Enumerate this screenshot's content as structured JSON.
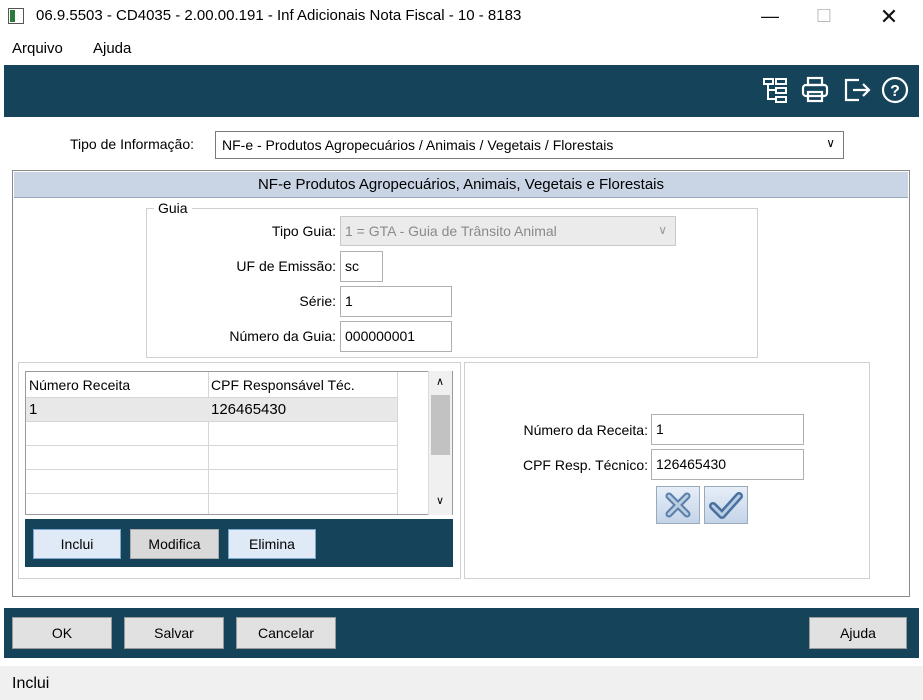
{
  "window": {
    "title": "06.9.5503 - CD4035 - 2.00.00.191 - Inf Adicionais Nota Fiscal - 10 - 8183",
    "min_glyph": "—",
    "max_glyph": "☐",
    "close_glyph": "✕"
  },
  "menu": {
    "items": [
      "Arquivo",
      "Ajuda"
    ]
  },
  "toolbar": {
    "icons": [
      "hierarchy-icon",
      "print-icon",
      "exit-icon",
      "help-icon"
    ]
  },
  "tipo_info": {
    "label": "Tipo de Informação:",
    "value": "NF-e - Produtos Agropecuários / Animais / Vegetais / Florestais"
  },
  "section": {
    "title": "NF-e  Produtos Agropecuários, Animais, Vegetais e Florestais",
    "guia": {
      "legend": "Guia",
      "tipo_guia_label": "Tipo Guia:",
      "tipo_guia_value": "1 = GTA - Guia de Trânsito Animal",
      "uf_label": "UF de Emissão:",
      "uf_value": "sc",
      "serie_label": "Série:",
      "serie_value": "1",
      "numero_label": "Número da Guia:",
      "numero_value": "000000001"
    },
    "grid": {
      "columns": [
        "Número Receita",
        "CPF Responsável Téc."
      ],
      "rows": [
        [
          "1",
          "126465430"
        ],
        [
          "",
          ""
        ],
        [
          "",
          ""
        ],
        [
          "",
          ""
        ],
        [
          "",
          ""
        ]
      ]
    },
    "grid_buttons": {
      "inclui": "Inclui",
      "modifica": "Modifica",
      "elimina": "Elimina"
    },
    "detail": {
      "numero_receita_label": "Número da Receita:",
      "numero_receita_value": "1",
      "cpf_label": "CPF Resp. Técnico:",
      "cpf_value": "126465430"
    }
  },
  "bottom_buttons": {
    "ok": "OK",
    "salvar": "Salvar",
    "cancelar": "Cancelar",
    "ajuda": "Ajuda"
  },
  "status": {
    "text": "Inclui"
  },
  "colors": {
    "bar": "#15435a",
    "section_header": "#c9d4e4",
    "accent_button": "#dfeaf6"
  }
}
